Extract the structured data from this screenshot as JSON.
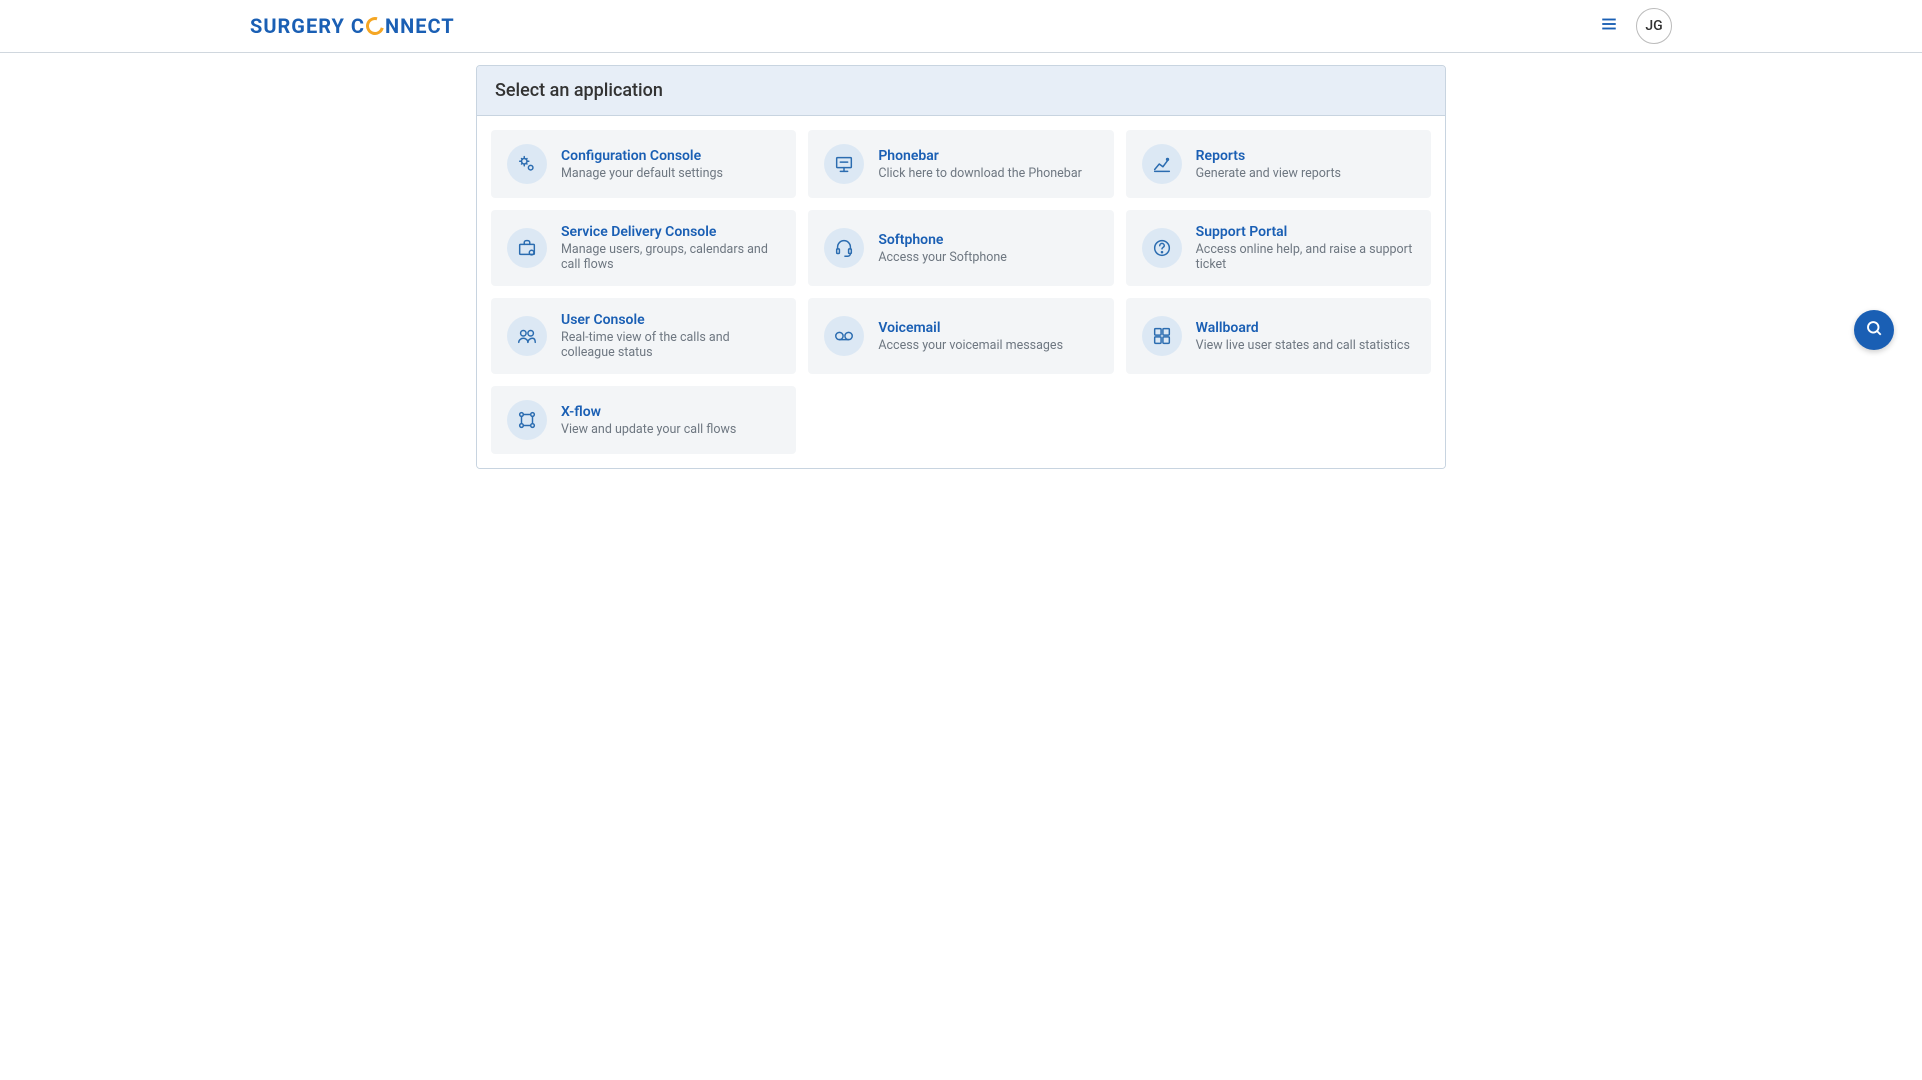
{
  "brand": {
    "part1": "SURGERY",
    "part2": "C",
    "part3": "NNECT"
  },
  "user": {
    "initials": "JG"
  },
  "panel": {
    "title": "Select an application"
  },
  "apps": [
    {
      "id": "configuration-console",
      "title": "Configuration Console",
      "desc": "Manage your default settings",
      "icon": "gears-icon"
    },
    {
      "id": "phonebar",
      "title": "Phonebar",
      "desc": "Click here to download the Phonebar",
      "icon": "monitor-icon"
    },
    {
      "id": "reports",
      "title": "Reports",
      "desc": "Generate and view reports",
      "icon": "chart-icon"
    },
    {
      "id": "service-delivery-console",
      "title": "Service Delivery Console",
      "desc": "Manage users, groups, calendars and call flows",
      "icon": "briefcase-icon"
    },
    {
      "id": "softphone",
      "title": "Softphone",
      "desc": "Access your Softphone",
      "icon": "headset-icon"
    },
    {
      "id": "support-portal",
      "title": "Support Portal",
      "desc": "Access online help, and raise a support ticket",
      "icon": "help-icon"
    },
    {
      "id": "user-console",
      "title": "User Console",
      "desc": "Real-time view of the calls and colleague status",
      "icon": "users-icon"
    },
    {
      "id": "voicemail",
      "title": "Voicemail",
      "desc": "Access your voicemail messages",
      "icon": "voicemail-icon"
    },
    {
      "id": "wallboard",
      "title": "Wallboard",
      "desc": "View live user states and call statistics",
      "icon": "grid-icon"
    },
    {
      "id": "x-flow",
      "title": "X-flow",
      "desc": "View and update your call flows",
      "icon": "flow-icon"
    }
  ]
}
